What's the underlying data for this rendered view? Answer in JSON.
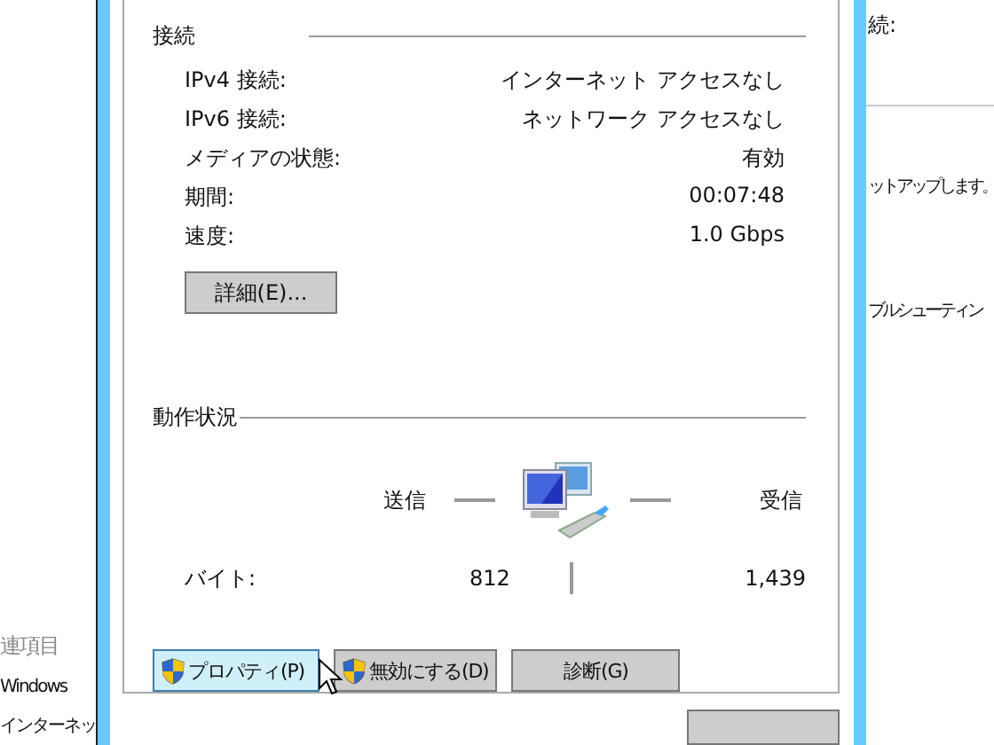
{
  "background_left": {
    "heading": "連項目",
    "items": [
      "Windows",
      "インターネッ"
    ]
  },
  "background_right": {
    "items": [
      "続:",
      "ットアップします。",
      "ブルシューティン"
    ]
  },
  "connection": {
    "heading": "接続",
    "rows": [
      {
        "label": "IPv4 接続:",
        "value": "インターネット アクセスなし"
      },
      {
        "label": "IPv6 接続:",
        "value": "ネットワーク アクセスなし"
      },
      {
        "label": "メディアの状態:",
        "value": "有効"
      },
      {
        "label": "期間:",
        "value": "00:07:48"
      },
      {
        "label": "速度:",
        "value": "1.0 Gbps"
      }
    ],
    "details_button": "詳細(E)..."
  },
  "activity": {
    "heading": "動作状況",
    "sent_label": "送信",
    "received_label": "受信",
    "bytes_label": "バイト:",
    "bytes_sent": "812",
    "bytes_received": "1,439"
  },
  "buttons": [
    {
      "label": "プロパティ(P)",
      "shield": true,
      "hovered": true
    },
    {
      "label": "無効にする(D)",
      "shield": true,
      "hovered": false
    },
    {
      "label": "診断(G)",
      "shield": false,
      "hovered": false
    }
  ]
}
